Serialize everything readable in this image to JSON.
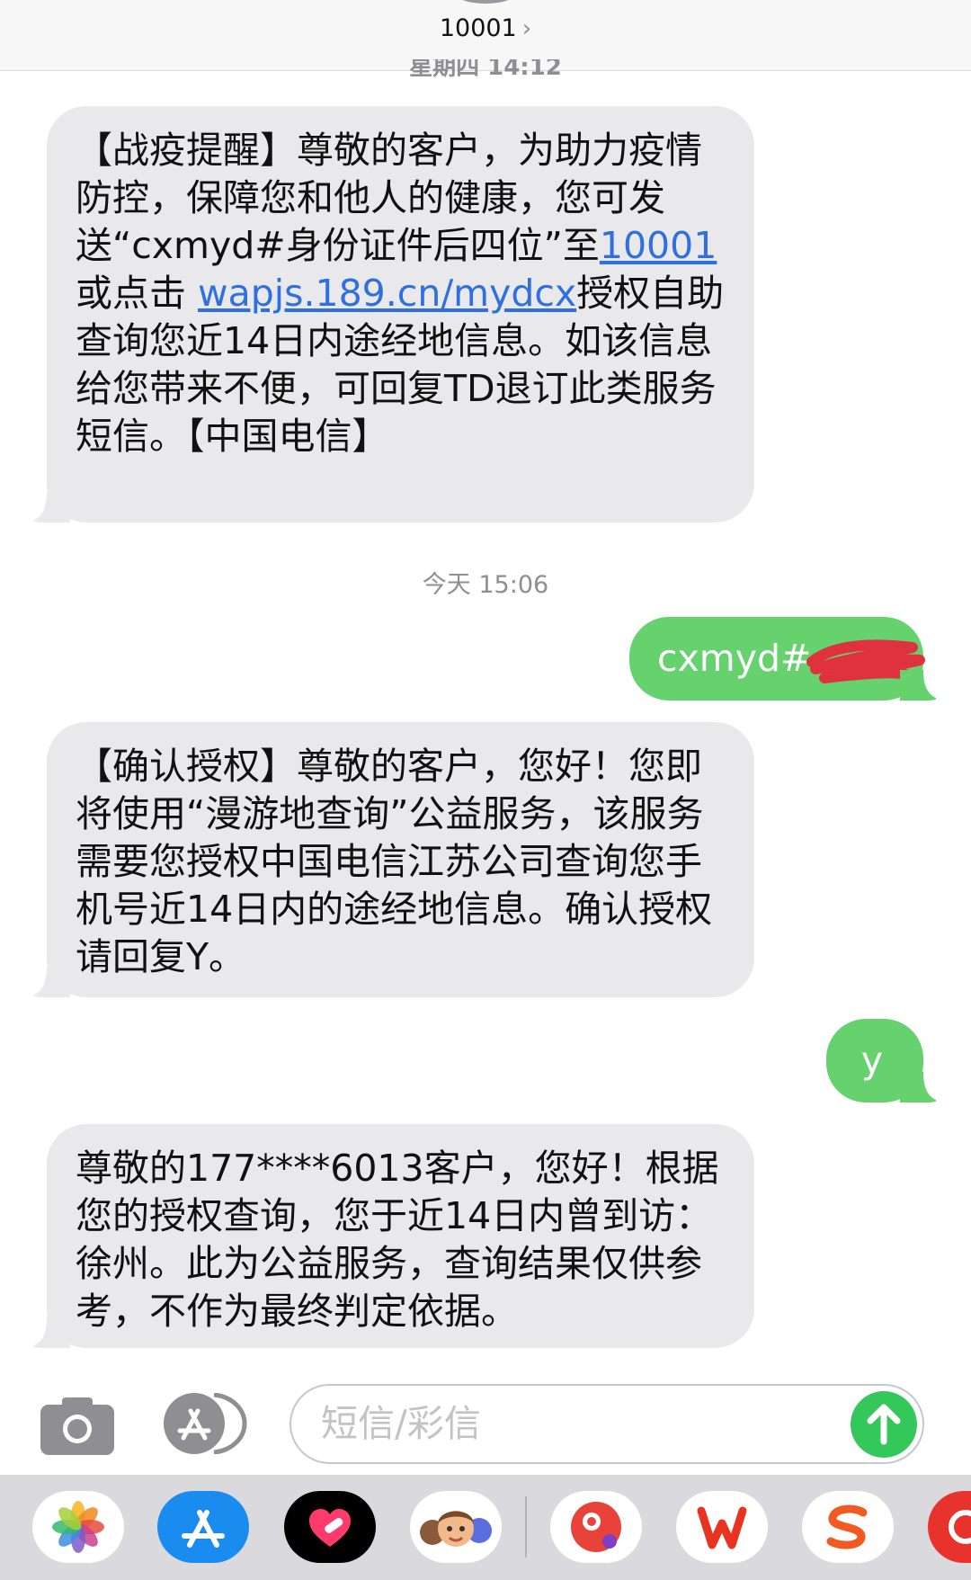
{
  "header": {
    "contact": "10001",
    "chevron": "›",
    "prev_timestamp": "星期四 14:12"
  },
  "timestamp": "今天 15:06",
  "messages": {
    "m1": {
      "t1": "【战疫提醒】尊敬的客户，为助力疫情防控，保障您和他人的健康，您可发送“cxmyd#身份证件后四位”至",
      "link1": "10001",
      "t2": "或点击 ",
      "link2": "wapjs.189.cn/mydcx",
      "t3": "授权自助查询您近14日内途经地信息。如该信息给您带来不便，可回复TD退订此类服务短信。【中国电信】"
    },
    "o1": "cxmyd#",
    "m2": "【确认授权】尊敬的客户，您好！您即将使用“漫游地查询”公益服务，该服务需要您授权中国电信江苏公司查询您手机号近14日内的途经地信息。确认授权请回复Y。",
    "o2": "y",
    "m3": "尊敬的177****6013客户，您好！根据您的授权查询，您于近14日内曾到访：徐州。此为公益服务，查询结果仅供参考，不作为最终判定依据。"
  },
  "input": {
    "placeholder": "短信/彩信"
  },
  "icons": {
    "camera": "camera-icon",
    "app_store": "app-store-icon",
    "send": "arrow-up-icon",
    "dock": [
      "photos-icon",
      "app-store-icon",
      "digital-touch-icon",
      "memoji-icon",
      "app-icon",
      "wps-icon",
      "sogou-icon",
      "app-icon"
    ]
  },
  "colors": {
    "incoming": "#e9e9eb",
    "outgoing": "#65d26e",
    "link": "#2f6fe0",
    "send": "#34c759"
  }
}
